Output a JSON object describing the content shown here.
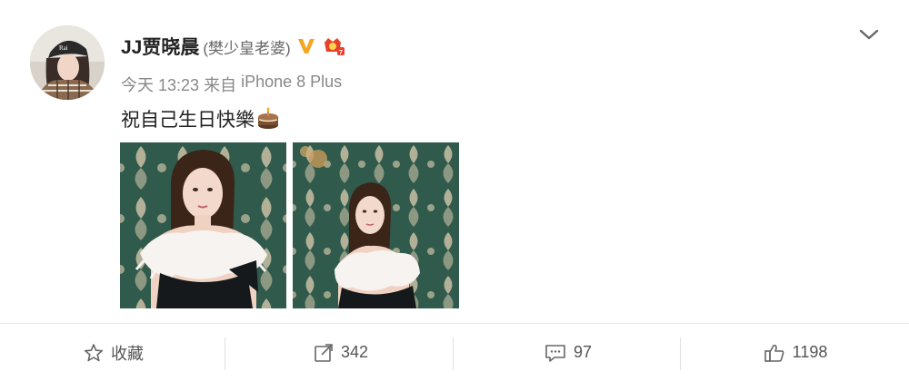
{
  "post": {
    "user": {
      "name": "JJ贾晓晨",
      "remark": "(樊少皇老婆)"
    },
    "meta": {
      "time": "今天 13:23",
      "source_prefix": "来自",
      "device": "iPhone 8 Plus"
    },
    "text": "祝自己生日快樂",
    "photo_count": 2
  },
  "actions": {
    "favorite_label": "收藏",
    "repost_count": "342",
    "comment_count": "97",
    "like_count": "1198"
  },
  "colors": {
    "verified_badge": "#f6a623",
    "vip_badge": "#e8412b",
    "wallpaper_green": "#2f5a4c",
    "wallpaper_pattern": "#c9c1a6"
  },
  "icons": [
    "chevron-down-icon",
    "verified-icon",
    "vip-icon",
    "cake-emoji-icon",
    "star-icon",
    "share-icon",
    "comment-icon",
    "thumbs-up-icon"
  ]
}
